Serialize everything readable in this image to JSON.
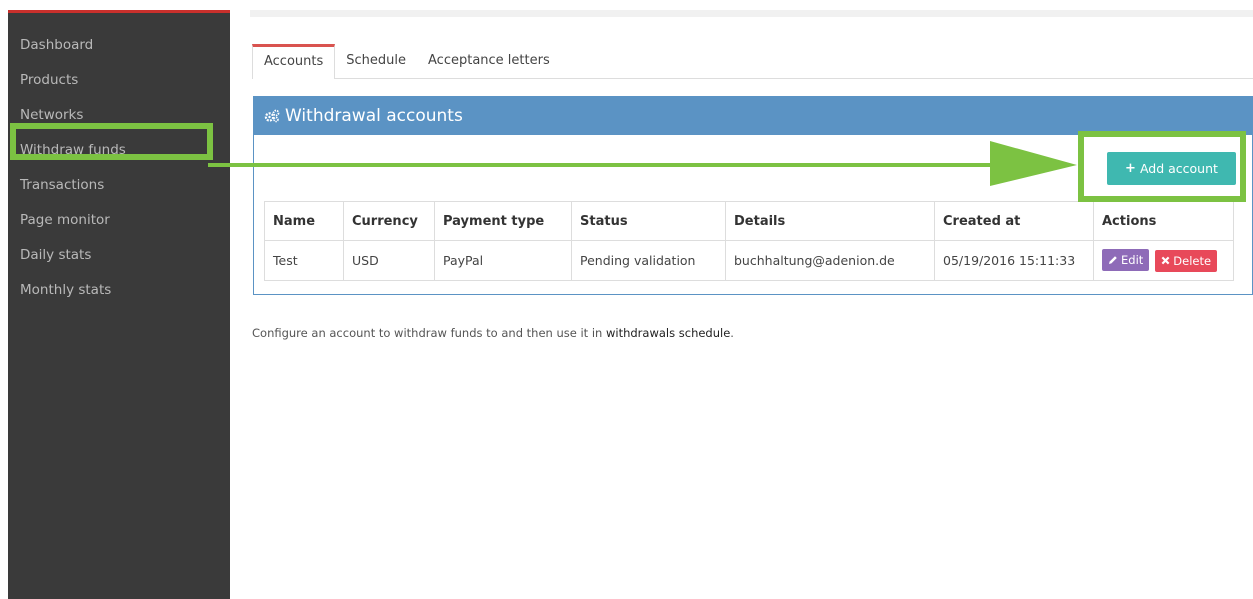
{
  "sidebar": {
    "items": [
      {
        "label": "Dashboard"
      },
      {
        "label": "Products"
      },
      {
        "label": "Networks"
      },
      {
        "label": "Withdraw funds"
      },
      {
        "label": "Transactions"
      },
      {
        "label": "Page monitor"
      },
      {
        "label": "Daily stats"
      },
      {
        "label": "Monthly stats"
      }
    ]
  },
  "tabs": [
    {
      "label": "Accounts",
      "active": true
    },
    {
      "label": "Schedule",
      "active": false
    },
    {
      "label": "Acceptance letters",
      "active": false
    }
  ],
  "panel": {
    "title": "Withdrawal accounts",
    "icon": "gears-icon",
    "add_button_label": "Add account",
    "table": {
      "headers": [
        "Name",
        "Currency",
        "Payment type",
        "Status",
        "Details",
        "Created at",
        "Actions"
      ],
      "rows": [
        {
          "name": "Test",
          "currency": "USD",
          "payment_type": "PayPal",
          "status": "Pending validation",
          "details": "buchhaltung@adenion.de",
          "created_at": "05/19/2016 15:11:33",
          "edit_label": "Edit",
          "delete_label": "Delete"
        }
      ]
    }
  },
  "help": {
    "text": "Configure an account to withdraw funds to and then use it in ",
    "link": "withdrawals schedule",
    "suffix": "."
  },
  "colors": {
    "sidebar_bg": "#3a3a3a",
    "panel_header": "#5b93c4",
    "add_button": "#3fb8b0",
    "edit_button": "#8e6bb8",
    "delete_button": "#e8495a",
    "annotation_green": "#7cc242"
  }
}
